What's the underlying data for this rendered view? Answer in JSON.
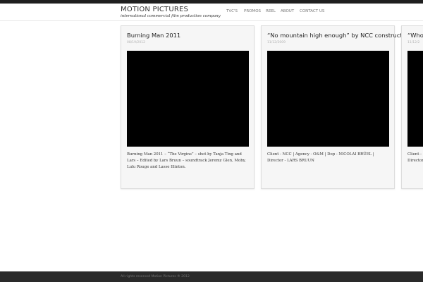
{
  "site": {
    "title": "MOTION PICTURES",
    "tagline": "international commercial film production company"
  },
  "nav": {
    "items": [
      "TVC'S",
      "PROMOS",
      "REEL",
      "ABOUT",
      "CONTACT US"
    ]
  },
  "posts": [
    {
      "title": "Burning Man 2011",
      "date": "08/19/2012",
      "description": "Burning Man 2011 – “The Virgins” – shot by Tanja Ting and Lars – Edited by Lars Bruun – soundtrack Jeremy Glen, Moby, Lulu Rouge and Lasse Illinton."
    },
    {
      "title": "“No mountain high enough” by NCC construction",
      "date": "11/12/2009",
      "description": "Client - NCC | Agency - O&M | Dop - NICOLAI BRÜEL | Director - LARS BRUUN"
    },
    {
      "title": "“Who",
      "date": "11/12/2",
      "description": "Client - Director"
    }
  ],
  "footer": {
    "text": "All rights reserved Motion Pictures ® 2012"
  }
}
